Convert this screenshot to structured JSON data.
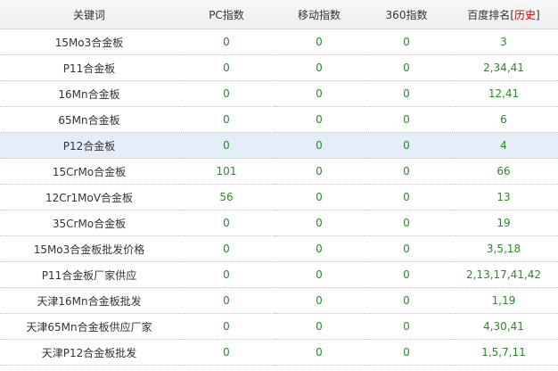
{
  "headers": {
    "keyword": "关键词",
    "pc_index": "PC指数",
    "mobile_index": "移动指数",
    "index_360": "360指数",
    "baidu_rank": "百度排名",
    "history_open": "[",
    "history_label": "历史",
    "history_close": "]"
  },
  "rows": [
    {
      "keyword": "15Mo3合金板",
      "pc": "0",
      "mobile": "0",
      "i360": "0",
      "rank": "3"
    },
    {
      "keyword": "P11合金板",
      "pc": "0",
      "mobile": "0",
      "i360": "0",
      "rank": "2,34,41"
    },
    {
      "keyword": "16Mn合金板",
      "pc": "0",
      "mobile": "0",
      "i360": "0",
      "rank": "12,41"
    },
    {
      "keyword": "65Mn合金板",
      "pc": "0",
      "mobile": "0",
      "i360": "0",
      "rank": "6"
    },
    {
      "keyword": "P12合金板",
      "pc": "0",
      "mobile": "0",
      "i360": "0",
      "rank": "4"
    },
    {
      "keyword": "15CrMo合金板",
      "pc": "101",
      "mobile": "0",
      "i360": "0",
      "rank": "66"
    },
    {
      "keyword": "12Cr1MoV合金板",
      "pc": "56",
      "mobile": "0",
      "i360": "0",
      "rank": "13"
    },
    {
      "keyword": "35CrMo合金板",
      "pc": "0",
      "mobile": "0",
      "i360": "0",
      "rank": "19"
    },
    {
      "keyword": "15Mo3合金板批发价格",
      "pc": "0",
      "mobile": "0",
      "i360": "0",
      "rank": "3,5,18"
    },
    {
      "keyword": "P11合金板厂家供应",
      "pc": "0",
      "mobile": "0",
      "i360": "0",
      "rank": "2,13,17,41,42"
    },
    {
      "keyword": "天津16Mn合金板批发",
      "pc": "0",
      "mobile": "0",
      "i360": "0",
      "rank": "1,19"
    },
    {
      "keyword": "天津65Mn合金板供应厂家",
      "pc": "0",
      "mobile": "0",
      "i360": "0",
      "rank": "4,30,41"
    },
    {
      "keyword": "天津P12合金板批发",
      "pc": "0",
      "mobile": "0",
      "i360": "0",
      "rank": "1,5,7,11"
    }
  ],
  "highlighted_row_index": 4,
  "colors": {
    "header_bg": "#f2f2f2",
    "highlight_bg": "#e5eef8",
    "value_green": "#2a8a2a",
    "history_red": "#cc0000"
  }
}
